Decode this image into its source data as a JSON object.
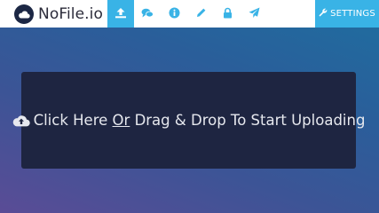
{
  "header": {
    "brand_name": "NoFile.io",
    "nav": [
      {
        "icon": "upload-icon",
        "active": true
      },
      {
        "icon": "comments-icon",
        "active": false
      },
      {
        "icon": "info-icon",
        "active": false
      },
      {
        "icon": "pencil-icon",
        "active": false
      },
      {
        "icon": "lock-icon",
        "active": false
      },
      {
        "icon": "paper-plane-icon",
        "active": false
      }
    ],
    "settings_label": "SETTINGS"
  },
  "upload": {
    "text_before": "Click Here",
    "or_text": "Or",
    "text_after": "Drag & Drop To Start Uploading"
  },
  "colors": {
    "accent": "#39b3e6",
    "dropzone_bg": "#1e2541",
    "header_bg": "#ffffff"
  }
}
